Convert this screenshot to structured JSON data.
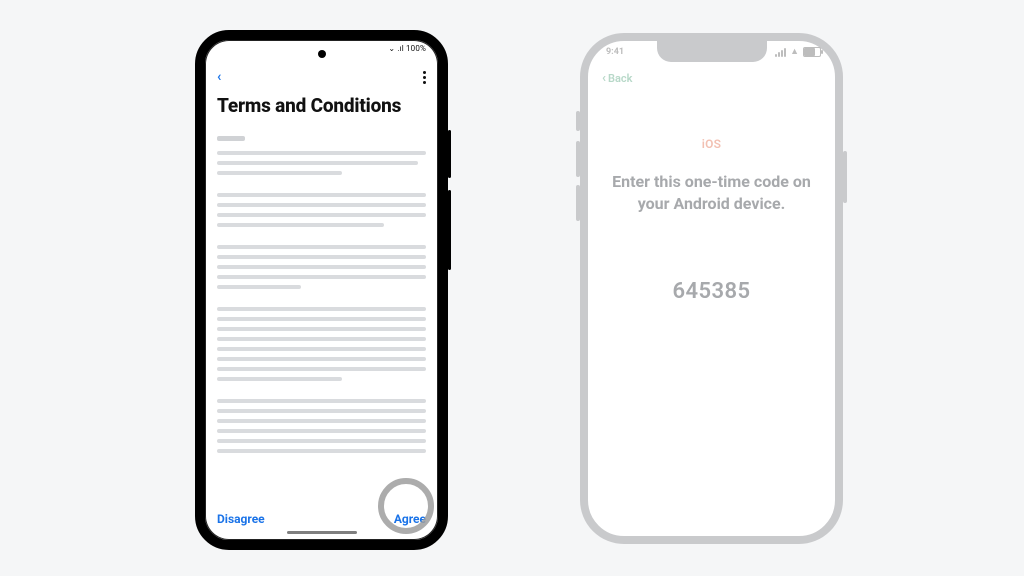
{
  "android": {
    "status_text": "⌄ .ıl 100%",
    "title": "Terms and Conditions",
    "actions": {
      "disagree": "Disagree",
      "agree": "Agree"
    }
  },
  "ios": {
    "status_time": "9:41",
    "back_label": "Back",
    "brand": "iOS",
    "message": "Enter this one-time code on your Android device.",
    "code": "645385"
  }
}
